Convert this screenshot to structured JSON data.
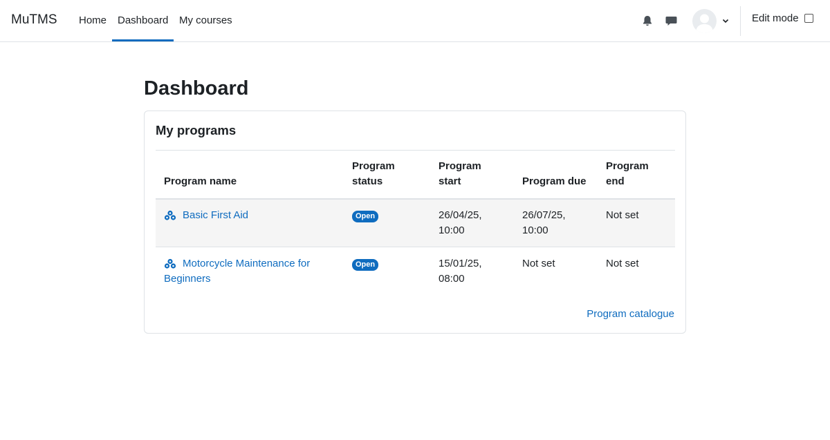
{
  "navbar": {
    "brand": "MuTMS",
    "links": [
      {
        "label": "Home"
      },
      {
        "label": "Dashboard",
        "active": true
      },
      {
        "label": "My courses"
      }
    ],
    "edit_mode_label": "Edit mode",
    "edit_mode_checked": false,
    "icons": [
      "bell-icon",
      "message-icon",
      "avatar",
      "chevron-down-icon"
    ]
  },
  "page": {
    "title": "Dashboard"
  },
  "programs": {
    "title": "My programs",
    "columns": [
      {
        "line1": "",
        "line2": "Program name"
      },
      {
        "line1": "Program",
        "line2": "status"
      },
      {
        "line1": "Program",
        "line2": "start"
      },
      {
        "line1": "",
        "line2": "Program due"
      },
      {
        "line1": "Program",
        "line2": "end"
      }
    ],
    "rows": [
      {
        "name": "Basic First Aid",
        "status": "Open",
        "start_line1": "26/04/25,",
        "start_line2": "10:00",
        "due_line1": "26/07/25,",
        "due_line2": "10:00",
        "end": "Not set"
      },
      {
        "name_line1": "Motorcycle Maintenance for",
        "name_line2": "Beginners",
        "status": "Open",
        "start_line1": "15/01/25,",
        "start_line2": "08:00",
        "due": "Not set",
        "end": "Not set"
      }
    ],
    "catalogue_link": "Program catalogue"
  },
  "colors": {
    "accent": "#0f6cbf",
    "text": "#1d2125",
    "border": "#dee2e6",
    "row_highlight": "#f5f5f5"
  }
}
